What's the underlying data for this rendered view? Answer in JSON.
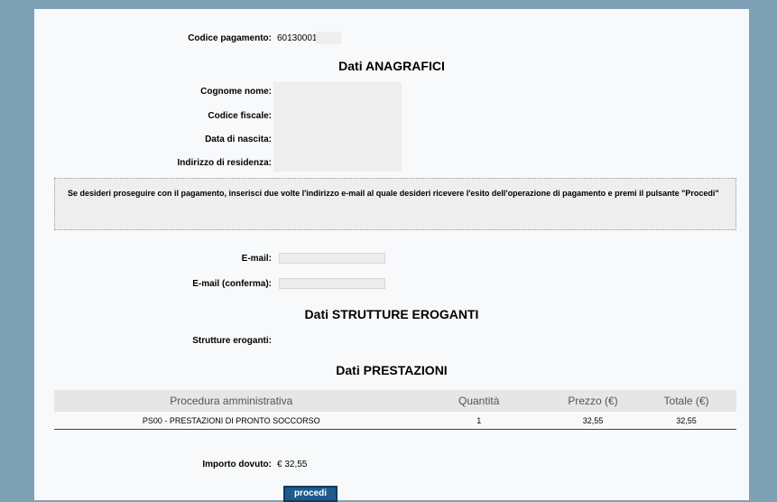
{
  "payment": {
    "label": "Codice pagamento:",
    "value": "60130001"
  },
  "anagrafici": {
    "heading": "Dati ANAGRAFICI",
    "fields": [
      {
        "label": "Cognome nome:"
      },
      {
        "label": "Codice fiscale:"
      },
      {
        "label": "Data di nascita:"
      },
      {
        "label": "Indirizzo di residenza:"
      }
    ]
  },
  "notice": "Se desideri proseguire con il pagamento, inserisci due volte l'indirizzo e-mail al quale desideri ricevere l'esito dell'operazione di pagamento e premi il pulsante \"Procedi\"",
  "email": {
    "label": "E-mail:",
    "value": "",
    "confirm_label": "E-mail (conferma):",
    "confirm_value": ""
  },
  "strutture": {
    "heading": "Dati STRUTTURE EROGANTI",
    "label": "Strutture eroganti:"
  },
  "prestazioni": {
    "heading": "Dati PRESTAZIONI",
    "columns": [
      "Procedura amministrativa",
      "Quantità",
      "Prezzo (€)",
      "Totale (€)"
    ],
    "rows": [
      [
        "PS00 - PRESTAZIONI DI PRONTO SOCCORSO",
        "1",
        "32,55",
        "32,55"
      ]
    ]
  },
  "importo": {
    "label": "Importo dovuto:",
    "value": "€ 32,55"
  },
  "procedi_label": "procedi"
}
